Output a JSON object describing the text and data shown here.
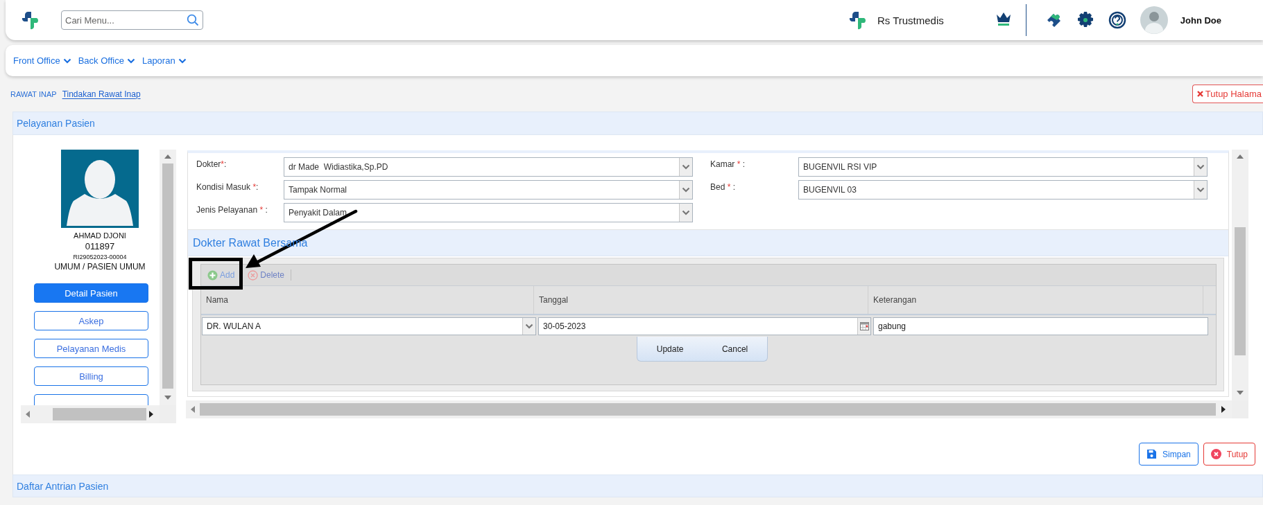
{
  "header": {
    "search": {
      "placeholder": "Cari Menu..."
    },
    "hospital": "Rs Trustmedis",
    "user": "John Doe"
  },
  "menu": [
    {
      "label": "Front Office"
    },
    {
      "label": "Back Office"
    },
    {
      "label": "Laporan"
    }
  ],
  "breadcrumb": [
    {
      "label": "RAWAT INAP",
      "selected": false
    },
    {
      "label": "Tindakan Rawat Inap",
      "selected": true
    }
  ],
  "close_page_button": "Tutup Halama",
  "panel": {
    "title": "Pelayanan Pasien",
    "patient": {
      "name": "AHMAD DJONI",
      "mrn": "011897",
      "registration": "RI29052023-00004",
      "payer": "UMUM / PASIEN UMUM"
    },
    "side_buttons": [
      {
        "label": "Detail Pasien",
        "selected": true
      },
      {
        "label": "Askep",
        "selected": false
      },
      {
        "label": "Pelayanan Medis",
        "selected": false
      },
      {
        "label": "Billing",
        "selected": false
      },
      {
        "selected": false
      }
    ],
    "form_left": [
      {
        "label": "Dokter",
        "required_mark": "*",
        "suffix": ":",
        "value": "dr Made  Widiastika,Sp.PD"
      },
      {
        "label": "Kondisi Masuk ",
        "required_mark": "*",
        "suffix": ":",
        "value": "Tampak Normal"
      },
      {
        "label": "Jenis Pelayanan ",
        "required_mark": "*",
        "suffix": " :",
        "value": "Penyakit Dalam"
      }
    ],
    "form_right": [
      {
        "label": "Kamar ",
        "required_mark": "*",
        "suffix": " :",
        "value": "BUGENVIL RSI VIP"
      },
      {
        "label": "Bed ",
        "required_mark": "*",
        "suffix": " :",
        "value": "BUGENVIL 03"
      }
    ],
    "section": "Dokter Rawat Bersama",
    "grid": {
      "toolbar": [
        {
          "label": "Add",
          "kind": "add"
        },
        {
          "label": "Delete",
          "kind": "delete"
        }
      ],
      "columns": [
        "Nama",
        "Tanggal",
        "Keterangan"
      ],
      "editor": {
        "nama": "DR. WULAN A",
        "tanggal": "30-05-2023",
        "keterangan": "gabung"
      },
      "editor_buttons": [
        "Update",
        "Cancel"
      ]
    },
    "actions": [
      {
        "label": "Simpan",
        "kind": "save"
      },
      {
        "label": "Tutup",
        "kind": "close"
      }
    ]
  },
  "queue_panel": {
    "title": "Daftar Antrian Pasien"
  }
}
